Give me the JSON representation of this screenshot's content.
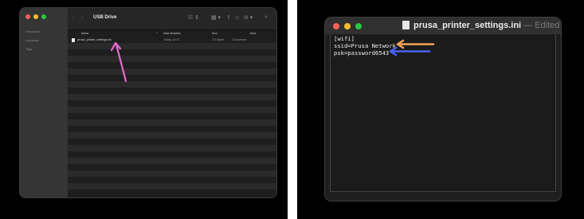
{
  "finder": {
    "title": "USB Drive",
    "nav_back": "‹",
    "nav_forward": "›",
    "sidebar_sections": [
      "Favourites",
      "Locations",
      "Tags"
    ],
    "toolbar_icons": {
      "view": "☷ ⇕",
      "grid": "▦ ▾",
      "share": "⇧",
      "tag": "◇",
      "action": "⊖ ▾",
      "search": "⌕"
    },
    "columns": {
      "name": "Name",
      "sort": "^",
      "date": "Date Modified",
      "size": "Size",
      "kind": "Kind"
    },
    "files": [
      {
        "name": "prusa_printer_settings.ini",
        "date": "Today 14:47",
        "size": "51 bytes",
        "kind": "Document"
      }
    ],
    "arrow_color": "#e86ad0"
  },
  "textedit": {
    "filename": "prusa_printer_settings.ini",
    "status": " — Edited",
    "lines": [
      "[wifi]",
      "ssid=Prusa Network",
      "psk=password6543"
    ],
    "ssid_arrow_color": "#f5a35a",
    "psk_arrow_color": "#4a64f0"
  },
  "colors": {
    "close": "#fe5f57",
    "minimize": "#febc2e",
    "maximize": "#28c840"
  }
}
